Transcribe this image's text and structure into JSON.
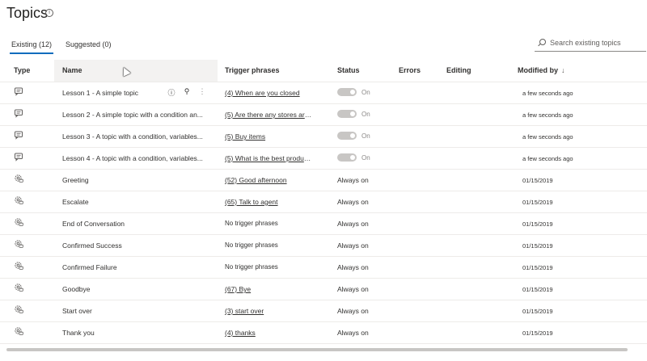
{
  "page": {
    "title": "Topics",
    "title_info_icon": "info-icon"
  },
  "tabs": [
    {
      "label": "Existing (12)",
      "active": true
    },
    {
      "label": "Suggested (0)",
      "active": false
    }
  ],
  "search": {
    "placeholder": "Search existing topics",
    "icon": "search-icon"
  },
  "columns": {
    "type": "Type",
    "name": "Name",
    "trigger": "Trigger phrases",
    "status": "Status",
    "errors": "Errors",
    "editing": "Editing",
    "modified": "Modified by",
    "modified_sort_icon": "↓"
  },
  "rows": [
    {
      "type_icon": "chat-bubble-icon",
      "name": "Lesson 1 - A simple topic",
      "trigger": "(4) When are you closed",
      "trigger_link": true,
      "status": "On",
      "toggle": true,
      "modified": "a few seconds ago",
      "actions": [
        "info-icon",
        "test-icon",
        "more-icon"
      ]
    },
    {
      "type_icon": "chat-bubble-icon",
      "name": "Lesson 2 - A simple topic with a condition an...",
      "trigger": "(5) Are there any stores aroun...",
      "trigger_link": true,
      "status": "On",
      "toggle": true,
      "modified": "a few seconds ago"
    },
    {
      "type_icon": "chat-bubble-icon",
      "name": "Lesson 3 - A topic with a condition, variables...",
      "trigger": "(5) Buy items",
      "trigger_link": true,
      "status": "On",
      "toggle": true,
      "modified": "a few seconds ago"
    },
    {
      "type_icon": "chat-bubble-icon",
      "name": "Lesson 4 - A topic with a condition, variables...",
      "trigger": "(5) What is the best product f...",
      "trigger_link": true,
      "status": "On",
      "toggle": true,
      "modified": "a few seconds ago"
    },
    {
      "type_icon": "system-gear-icon",
      "name": "Greeting",
      "trigger": "(52) Good afternoon",
      "trigger_link": true,
      "status": "Always on",
      "toggle": false,
      "modified": "01/15/2019"
    },
    {
      "type_icon": "system-gear-icon",
      "name": "Escalate",
      "trigger": "(65) Talk to agent",
      "trigger_link": true,
      "status": "Always on",
      "toggle": false,
      "modified": "01/15/2019"
    },
    {
      "type_icon": "system-gear-icon",
      "name": "End of Conversation",
      "trigger": "No trigger phrases",
      "trigger_link": false,
      "status": "Always on",
      "toggle": false,
      "modified": "01/15/2019"
    },
    {
      "type_icon": "system-gear-icon",
      "name": "Confirmed Success",
      "trigger": "No trigger phrases",
      "trigger_link": false,
      "status": "Always on",
      "toggle": false,
      "modified": "01/15/2019"
    },
    {
      "type_icon": "system-gear-icon",
      "name": "Confirmed Failure",
      "trigger": "No trigger phrases",
      "trigger_link": false,
      "status": "Always on",
      "toggle": false,
      "modified": "01/15/2019"
    },
    {
      "type_icon": "system-gear-icon",
      "name": "Goodbye",
      "trigger": "(67) Bye",
      "trigger_link": true,
      "status": "Always on",
      "toggle": false,
      "modified": "01/15/2019"
    },
    {
      "type_icon": "system-gear-icon",
      "name": "Start over",
      "trigger": "(3) start over",
      "trigger_link": true,
      "status": "Always on",
      "toggle": false,
      "modified": "01/15/2019"
    },
    {
      "type_icon": "system-gear-icon",
      "name": "Thank you",
      "trigger": "(4) thanks",
      "trigger_link": true,
      "status": "Always on",
      "toggle": false,
      "modified": "01/15/2019"
    }
  ],
  "colors": {
    "accent": "#0f6cbd",
    "toggle_off": "#c8c6c4",
    "border": "#edebe9"
  }
}
